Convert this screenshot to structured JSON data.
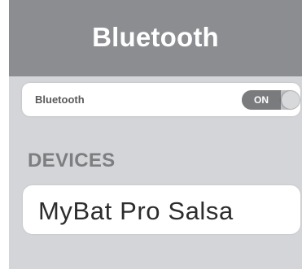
{
  "header": {
    "title": "Bluetooth"
  },
  "bluetooth_toggle": {
    "label": "Bluetooth",
    "state_text": "ON",
    "is_on": true
  },
  "devices": {
    "section_title": "DEVICES",
    "items": [
      {
        "name": "MyBat Pro Salsa"
      }
    ]
  },
  "colors": {
    "title_bar_bg": "#8b8d91",
    "screen_bg": "#d3d5d8",
    "row_bg": "#ffffff",
    "switch_on_bg": "#7a7b7d"
  }
}
